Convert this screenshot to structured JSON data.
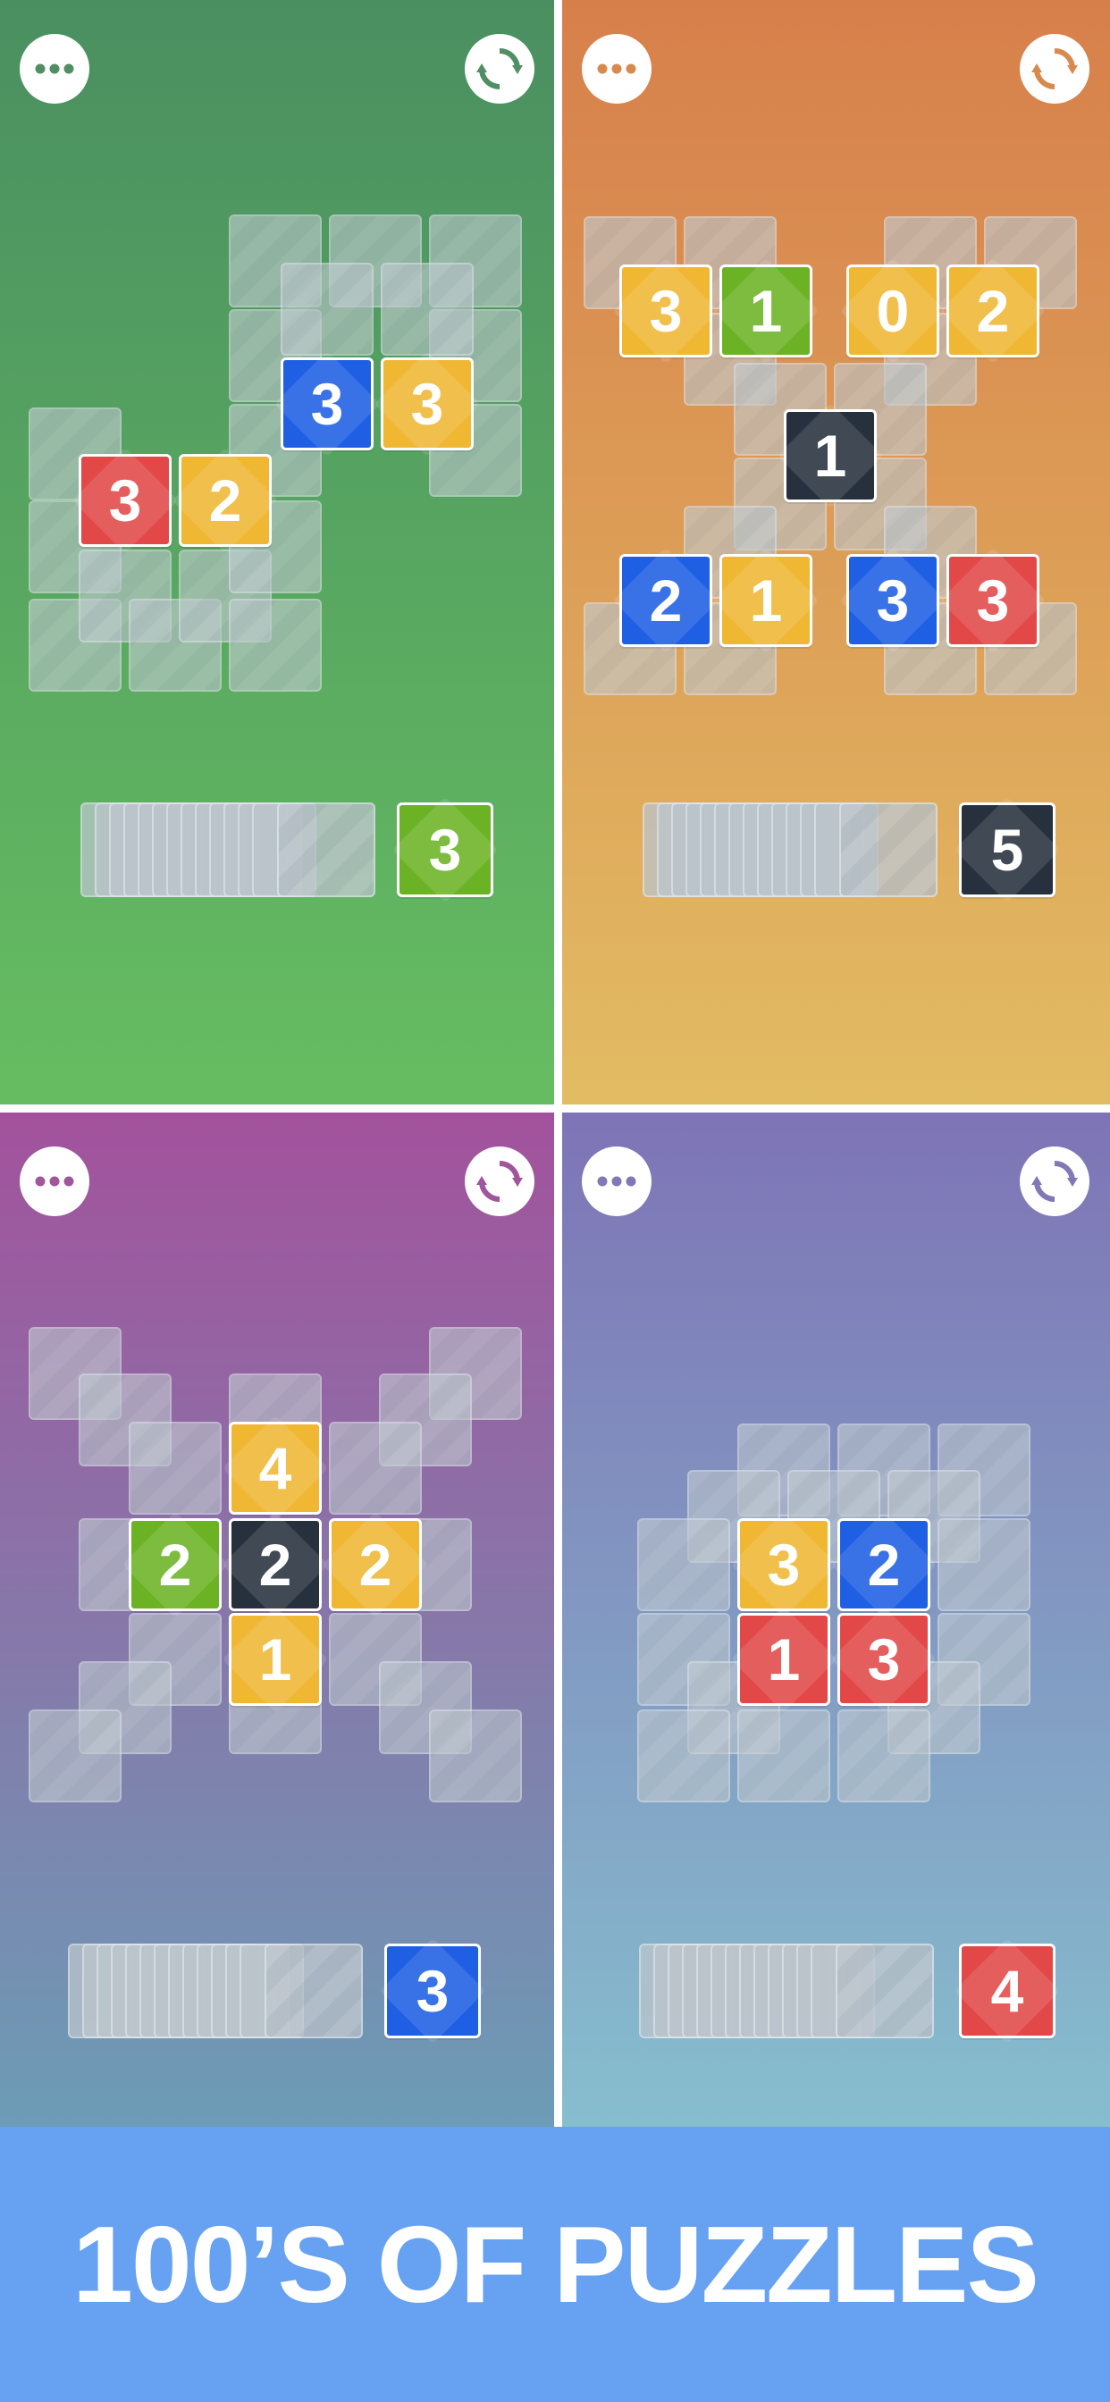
{
  "colors": {
    "red": "#e24848",
    "yellow": "#f0b733",
    "blue": "#1e5fe3",
    "green": "#6bb324",
    "dark": "#27313d",
    "banner": "#66a1f2"
  },
  "icons": {
    "menu": "three-dots-icon",
    "reload": "reload-arrows-icon"
  },
  "banner": {
    "text": "100’S OF PUZZLES"
  },
  "panels": [
    {
      "name": "green-puzzle",
      "tiles": [
        {
          "value": "3",
          "color": "red"
        },
        {
          "value": "2",
          "color": "yellow"
        },
        {
          "value": "3",
          "color": "blue"
        },
        {
          "value": "3",
          "color": "yellow"
        }
      ],
      "next_card": {
        "value": "3",
        "color": "green"
      }
    },
    {
      "name": "orange-puzzle",
      "tiles": [
        {
          "value": "3",
          "color": "yellow"
        },
        {
          "value": "1",
          "color": "green"
        },
        {
          "value": "0",
          "color": "yellow"
        },
        {
          "value": "2",
          "color": "yellow"
        },
        {
          "value": "1",
          "color": "dark"
        },
        {
          "value": "2",
          "color": "blue"
        },
        {
          "value": "1",
          "color": "yellow"
        },
        {
          "value": "3",
          "color": "blue"
        },
        {
          "value": "3",
          "color": "red"
        }
      ],
      "next_card": {
        "value": "5",
        "color": "dark"
      }
    },
    {
      "name": "purple-puzzle",
      "tiles": [
        {
          "value": "4",
          "color": "yellow"
        },
        {
          "value": "2",
          "color": "green"
        },
        {
          "value": "2",
          "color": "dark"
        },
        {
          "value": "2",
          "color": "yellow"
        },
        {
          "value": "1",
          "color": "yellow"
        }
      ],
      "next_card": {
        "value": "3",
        "color": "blue"
      }
    },
    {
      "name": "lavender-puzzle",
      "tiles": [
        {
          "value": "3",
          "color": "yellow"
        },
        {
          "value": "2",
          "color": "blue"
        },
        {
          "value": "1",
          "color": "red"
        },
        {
          "value": "3",
          "color": "red"
        }
      ],
      "next_card": {
        "value": "4",
        "color": "red"
      }
    }
  ]
}
